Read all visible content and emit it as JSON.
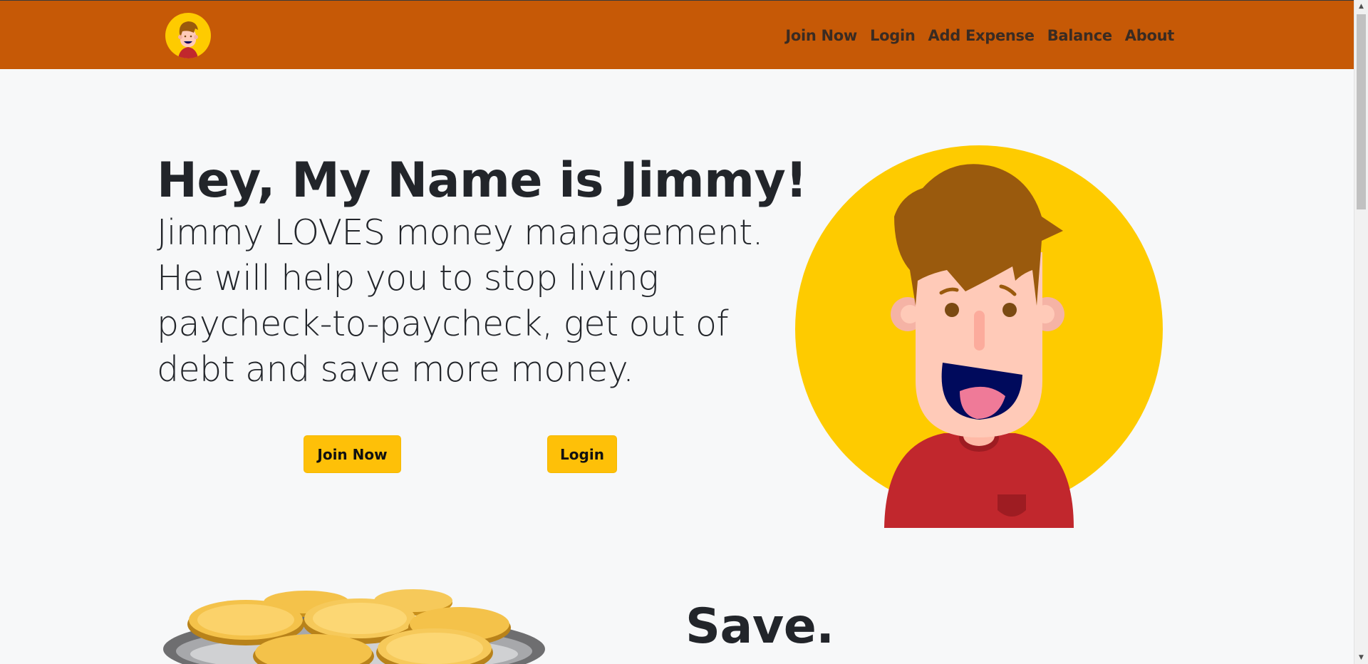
{
  "navbar": {
    "brand_logo": "jimmy-avatar-icon",
    "links": [
      {
        "label": "Join Now"
      },
      {
        "label": "Login"
      },
      {
        "label": "Add Expense"
      },
      {
        "label": "Balance"
      },
      {
        "label": "About"
      }
    ],
    "background_color": "#c65906"
  },
  "hero": {
    "title": "Hey, My Name is Jimmy!",
    "text": "Jimmy LOVES money management. He will help you to stop living paycheck-to-paycheck, get out of debt and save more money.",
    "join_button": "Join Now",
    "login_button": "Login",
    "button_color": "#fec008",
    "illustration": "jimmy-character-illustration"
  },
  "save_section": {
    "title": "Save.",
    "illustration": "coins-plate-illustration"
  },
  "scrollbar": {
    "up_arrow": "▲",
    "down_arrow": "▼"
  }
}
